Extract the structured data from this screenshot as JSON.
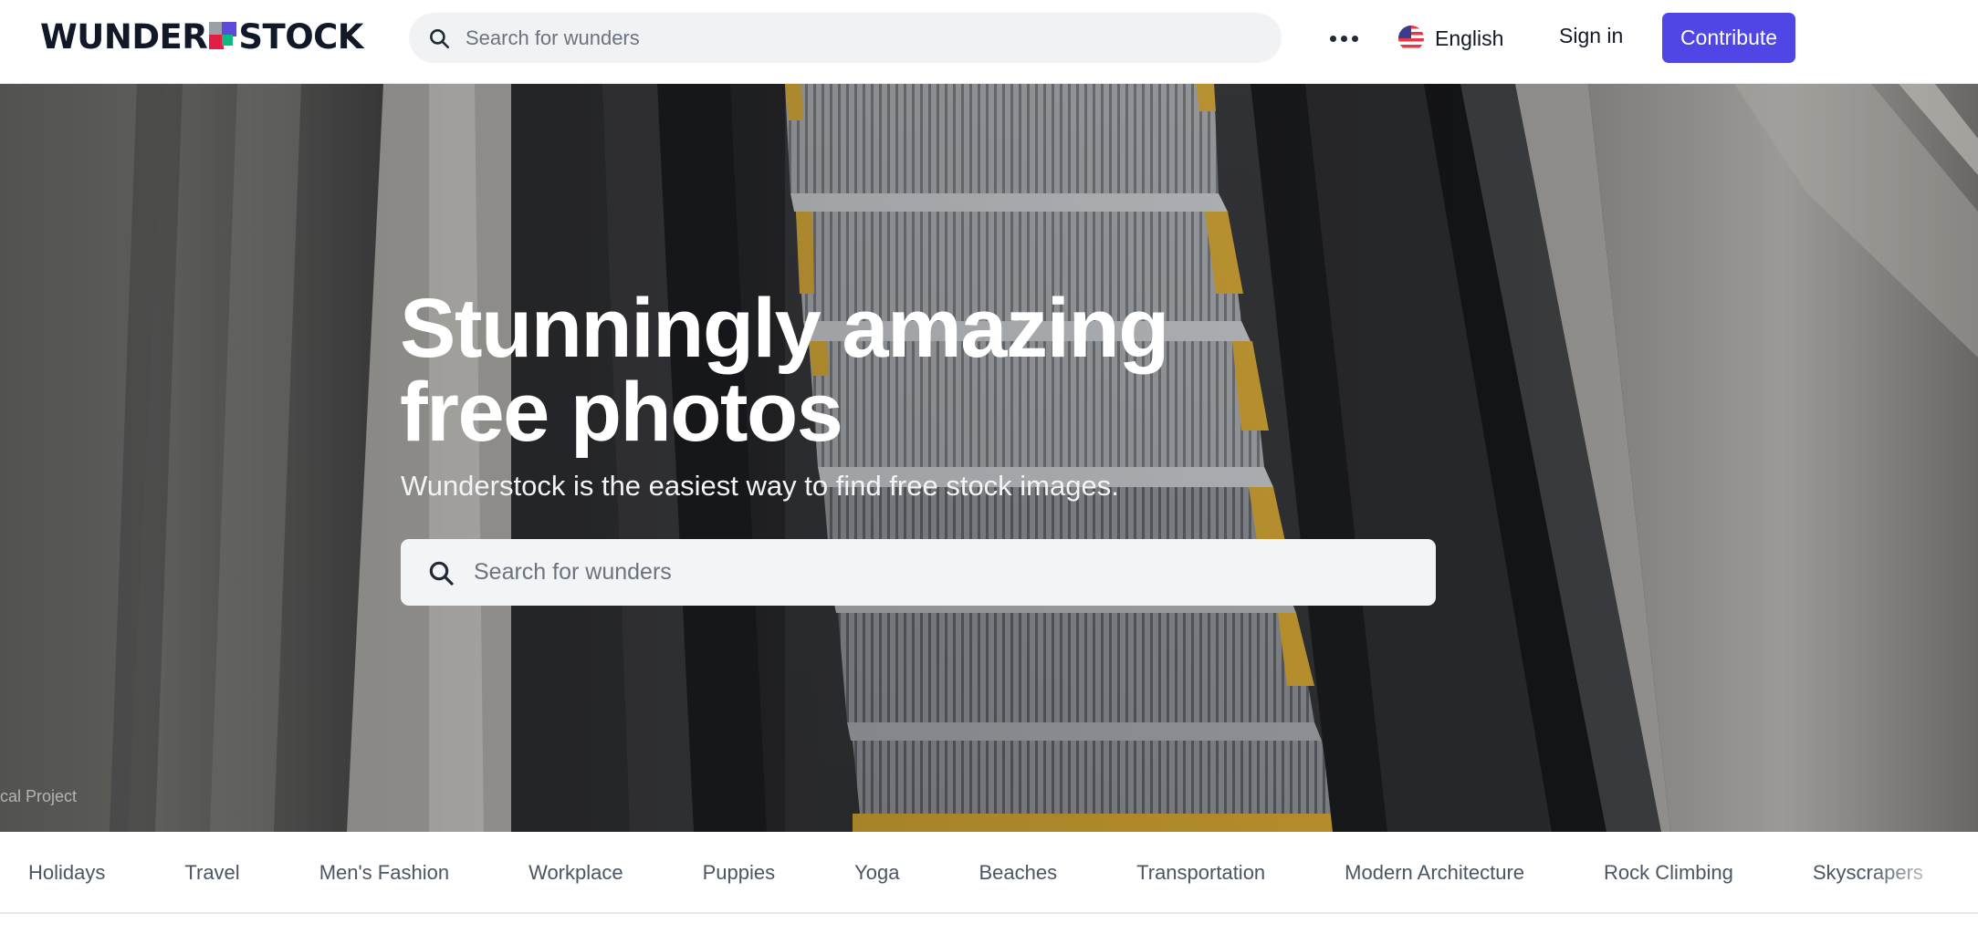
{
  "header": {
    "logo_left": "WUNDER",
    "logo_right": "STOCK",
    "search_placeholder": "Search for wunders",
    "more_icon": "ellipsis-icon",
    "language_label": "English",
    "language_flag": "us-flag-icon",
    "signin_label": "Sign in",
    "contribute_label": "Contribute"
  },
  "hero": {
    "title_line1": "Stunningly amazing",
    "title_line2": "free photos",
    "subtitle": "Wunderstock is the easiest way to find free stock images.",
    "search_placeholder": "Search for wunders",
    "photo_credit": "cal Project"
  },
  "categories": [
    "Holidays",
    "Travel",
    "Men's Fashion",
    "Workplace",
    "Puppies",
    "Yoga",
    "Beaches",
    "Transportation",
    "Modern Architecture",
    "Rock Climbing",
    "Skyscrapers"
  ],
  "colors": {
    "accent": "#4f46e5",
    "text_dark": "#111827",
    "search_bg": "#f1f2f4"
  }
}
